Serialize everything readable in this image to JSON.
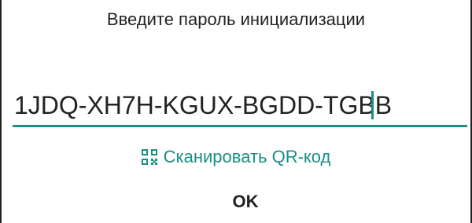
{
  "dialog": {
    "title": "Введите пароль инициализации",
    "password_value": "1JDQ-XH7H-KGUX-BGDD-TGBB",
    "scan_label": "Сканировать QR-код",
    "ok_label": "OK",
    "qr_icon": "qr-code-icon",
    "accent_color": "#1a8f85"
  }
}
